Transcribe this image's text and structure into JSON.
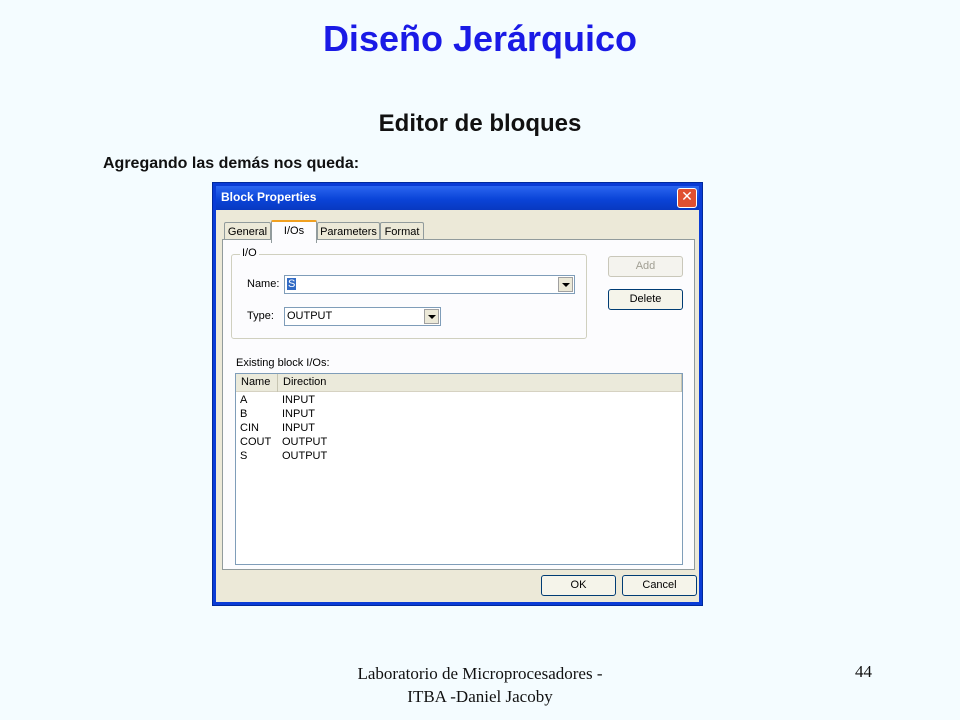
{
  "slide": {
    "title": "Diseño Jerárquico",
    "subtitle": "Editor de bloques",
    "caption": "Agregando las demás nos queda:",
    "footer_line1": "Laboratorio de Microprocesadores -",
    "footer_line2": "ITBA -Daniel Jacoby",
    "page_number": "44"
  },
  "dialog": {
    "title": "Block Properties",
    "close_glyph": "✕",
    "tabs": [
      {
        "label": "General",
        "active": false
      },
      {
        "label": "I/Os",
        "active": true
      },
      {
        "label": "Parameters",
        "active": false
      },
      {
        "label": "Format",
        "active": false
      }
    ],
    "io_group": {
      "legend": "I/O",
      "name_label": "Name:",
      "name_value": "S",
      "type_label": "Type:",
      "type_value": "OUTPUT"
    },
    "buttons": {
      "add": "Add",
      "delete": "Delete",
      "ok": "OK",
      "cancel": "Cancel"
    },
    "list_label": "Existing block I/Os:",
    "list": {
      "columns": [
        "Name",
        "Direction"
      ],
      "rows": [
        [
          "A",
          "INPUT"
        ],
        [
          "B",
          "INPUT"
        ],
        [
          "CIN",
          "INPUT"
        ],
        [
          "COUT",
          "OUTPUT"
        ],
        [
          "S",
          "OUTPUT"
        ]
      ]
    }
  }
}
